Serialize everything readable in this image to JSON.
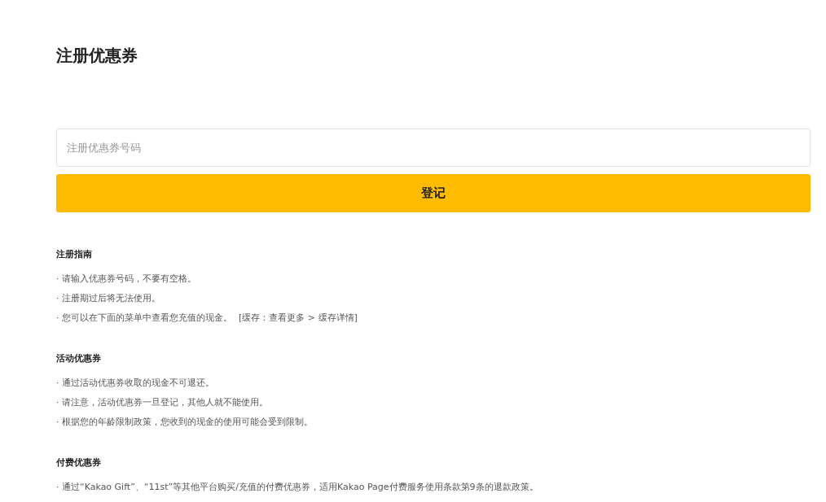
{
  "title": "注册优惠券",
  "coupon_field": {
    "placeholder": "注册优惠券号码"
  },
  "submit_button": {
    "label": "登记"
  },
  "sections": [
    {
      "heading": "注册指南",
      "items": [
        {
          "text": "· 请输入优惠券号码，不要有空格。"
        },
        {
          "text": "· 注册期过后将无法使用。"
        },
        {
          "text": "· 您可以在下面的菜单中查看您充值的现金。",
          "note": "[缓存：查看更多 > 缓存详情]"
        }
      ]
    },
    {
      "heading": "活动优惠券",
      "items": [
        {
          "text": "· 通过活动优惠券收取的现金不可退还。"
        },
        {
          "text": "· 请注意，活动优惠券一旦登记，其他人就不能使用。"
        },
        {
          "text": "· 根据您的年龄限制政策，您收到的现金的使用可能会受到限制。"
        }
      ]
    },
    {
      "heading": "付费优惠券",
      "items": [
        {
          "text": "· 通过“Kakao Gift”、“11st”等其他平台购买/充值的付费优惠券，适用Kakao Page付费服务使用条款第9条的退款政策。"
        }
      ]
    }
  ]
}
